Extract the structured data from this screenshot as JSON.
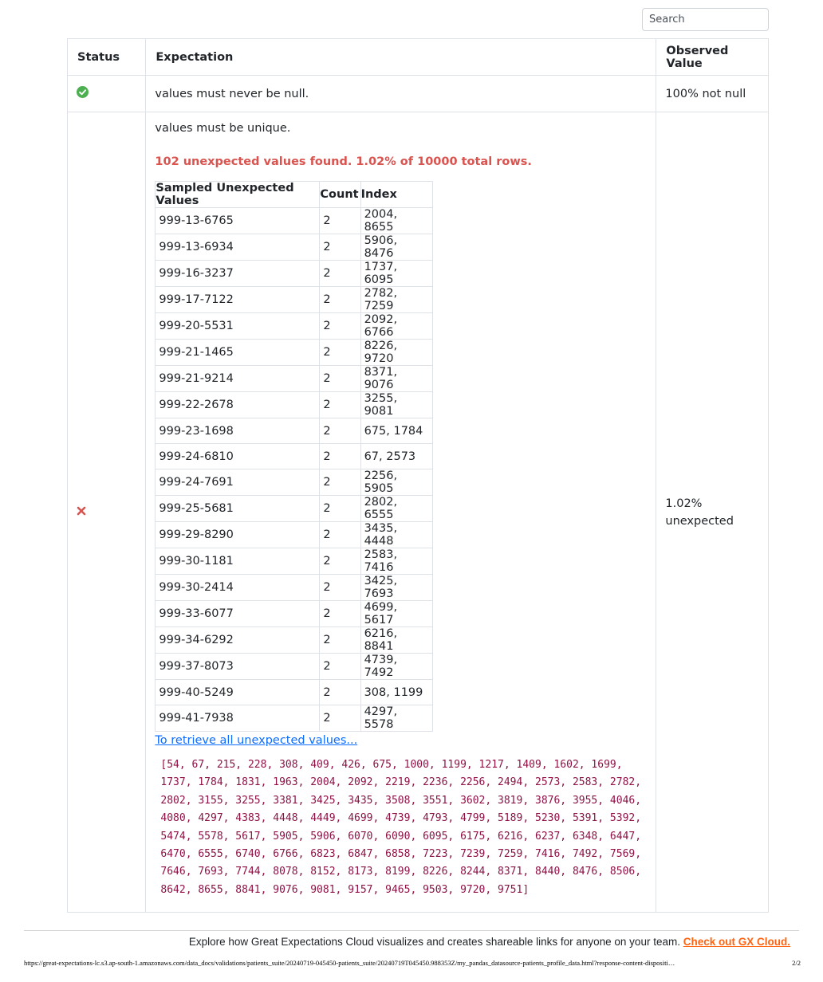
{
  "search": {
    "placeholder": "Search"
  },
  "table": {
    "headers": {
      "status": "Status",
      "expectation": "Expectation",
      "observed": "Observed Value"
    }
  },
  "rows": {
    "not_null": {
      "status": "success",
      "expectation": "values must never be null.",
      "observed": "100% not null"
    },
    "unique": {
      "status": "failed",
      "expectation": "values must be unique.",
      "summary": "102 unexpected values found. 1.02% of 10000 total rows.",
      "observed_line1": "1.02%",
      "observed_line2": "unexpected",
      "sample_headers": {
        "value": "Sampled Unexpected Values",
        "count": "Count",
        "index": "Index"
      },
      "samples": [
        {
          "value": "999-13-6765",
          "count": "2",
          "index": "2004, 8655"
        },
        {
          "value": "999-13-6934",
          "count": "2",
          "index": "5906, 8476"
        },
        {
          "value": "999-16-3237",
          "count": "2",
          "index": "1737, 6095"
        },
        {
          "value": "999-17-7122",
          "count": "2",
          "index": "2782, 7259"
        },
        {
          "value": "999-20-5531",
          "count": "2",
          "index": "2092, 6766"
        },
        {
          "value": "999-21-1465",
          "count": "2",
          "index": "8226, 9720"
        },
        {
          "value": "999-21-9214",
          "count": "2",
          "index": "8371, 9076"
        },
        {
          "value": "999-22-2678",
          "count": "2",
          "index": "3255, 9081"
        },
        {
          "value": "999-23-1698",
          "count": "2",
          "index": "675, 1784"
        },
        {
          "value": "999-24-6810",
          "count": "2",
          "index": "67, 2573"
        },
        {
          "value": "999-24-7691",
          "count": "2",
          "index": "2256, 5905"
        },
        {
          "value": "999-25-5681",
          "count": "2",
          "index": "2802, 6555"
        },
        {
          "value": "999-29-8290",
          "count": "2",
          "index": "3435, 4448"
        },
        {
          "value": "999-30-1181",
          "count": "2",
          "index": "2583, 7416"
        },
        {
          "value": "999-30-2414",
          "count": "2",
          "index": "3425, 7693"
        },
        {
          "value": "999-33-6077",
          "count": "2",
          "index": "4699, 5617"
        },
        {
          "value": "999-34-6292",
          "count": "2",
          "index": "6216, 8841"
        },
        {
          "value": "999-37-8073",
          "count": "2",
          "index": "4739, 7492"
        },
        {
          "value": "999-40-5249",
          "count": "2",
          "index": "308, 1199"
        },
        {
          "value": "999-41-7938",
          "count": "2",
          "index": "4297, 5578"
        }
      ],
      "retrieve_link": "To retrieve all unexpected values...",
      "unexpected_index_list": "[54, 67, 215, 228, 308, 409, 426, 675, 1000, 1199, 1217, 1409, 1602, 1699, 1737, 1784, 1831, 1963, 2004, 2092, 2219, 2236, 2256, 2494, 2573, 2583, 2782, 2802, 3155, 3255, 3381, 3425, 3435, 3508, 3551, 3602, 3819, 3876, 3955, 4046, 4080, 4297, 4383, 4448, 4449, 4699, 4739, 4793, 4799, 5189, 5230, 5391, 5392, 5474, 5578, 5617, 5905, 5906, 6070, 6090, 6095, 6175, 6216, 6237, 6348, 6447, 6470, 6555, 6740, 6766, 6823, 6847, 6858, 7223, 7239, 7259, 7416, 7492, 7569, 7646, 7693, 7744, 8078, 8152, 8173, 8199, 8226, 8244, 8371, 8440, 8476, 8506, 8642, 8655, 8841, 9076, 9081, 9157, 9465, 9503, 9720, 9751]"
    }
  },
  "footer": {
    "text": "Explore how Great Expectations Cloud visualizes and creates shareable links for anyone on your team.",
    "link": "Check out GX Cloud."
  },
  "print": {
    "url": "https://great-expectations-lc.s3.ap-south-1.amazonaws.com/data_docs/validations/patients_suite/20240719-045450-patients_suite/20240719T045450.988353Z/my_pandas_datasource-patients_profile_data.html?response-content-dispositi…",
    "page": "2/2"
  },
  "colors": {
    "success": "#4caf50",
    "failed": "#d9534f",
    "link": "#0d6efd",
    "code": "#8e1145",
    "gx_link": "#ff6310"
  },
  "icons": {
    "success": "check-circle-icon",
    "failed": "x-icon"
  }
}
